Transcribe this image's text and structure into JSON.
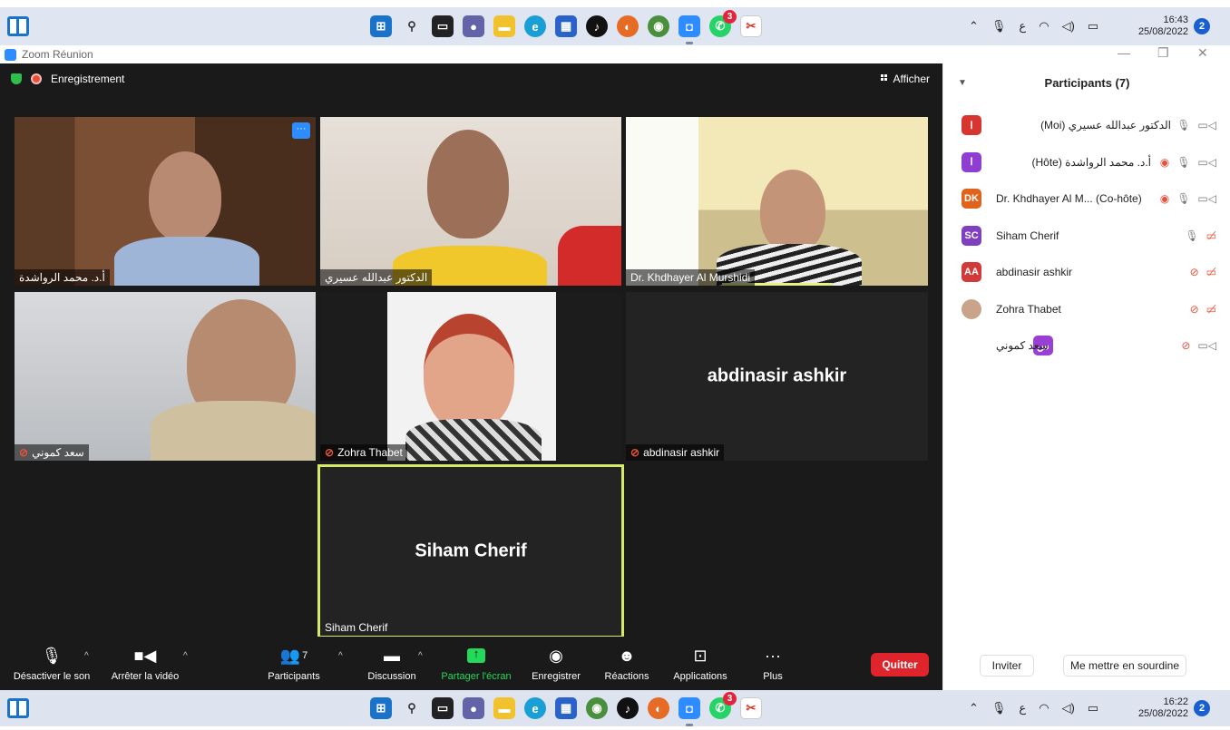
{
  "taskbar_top": {
    "clock_time": "16:43",
    "clock_date": "25/08/2022",
    "notif_count": "2",
    "whatsapp_badge": "3",
    "tray_lang": "ع"
  },
  "taskbar_bottom": {
    "clock_time": "16:22",
    "clock_date": "25/08/2022",
    "notif_count": "2",
    "whatsapp_badge": "3",
    "tray_lang": "ع"
  },
  "window": {
    "title": "Zoom Réunion"
  },
  "meeting": {
    "recording_label": "Enregistrement",
    "view_label": "Afficher",
    "more_dots": "···",
    "tiles": [
      {
        "name": "أ.د. محمد الرواشدة"
      },
      {
        "name": "الدكتور عبدالله عسيري"
      },
      {
        "name": "Dr. Khdhayer Al Murshidi"
      },
      {
        "name": "سعد كموني"
      },
      {
        "name": "Zohra Thabet"
      },
      {
        "name": "abdinasir ashkir",
        "center": "abdinasir ashkir"
      },
      {
        "name": "Siham Cherif",
        "center": "Siham Cherif"
      }
    ]
  },
  "toolbar": {
    "mute": "Désactiver le son",
    "video": "Arrêter la vidéo",
    "participants": "Participants",
    "participants_count": "7",
    "chat": "Discussion",
    "share": "Partager l'écran",
    "record": "Enregistrer",
    "reactions": "Réactions",
    "apps": "Applications",
    "more": "Plus",
    "more_icon": "···",
    "quit": "Quitter"
  },
  "panel": {
    "title": "Participants (7)",
    "participants": [
      {
        "name": "(Moi) الدكتور عبدالله عسيري",
        "initials": "ا",
        "color": "#d6362f"
      },
      {
        "name": "(Hôte) أ.د. محمد الرواشدة",
        "initials": "ا",
        "color": "#8e3fd1"
      },
      {
        "name": "Dr. Khdhayer Al M... (Co-hôte)",
        "initials": "DK",
        "color": "#e0631d"
      },
      {
        "name": "Siham Cherif",
        "initials": "SC",
        "color": "#7f3fbf"
      },
      {
        "name": "abdinasir ashkir",
        "initials": "AA",
        "color": "#d23a3a"
      },
      {
        "name": "Zohra Thabet",
        "initials": "",
        "color": "#c9a48a"
      },
      {
        "name": "سعد كموني",
        "initials": "س",
        "color": "#9a3fd6"
      }
    ],
    "invite": "Inviter",
    "mute_me": "Me mettre en sourdine"
  }
}
